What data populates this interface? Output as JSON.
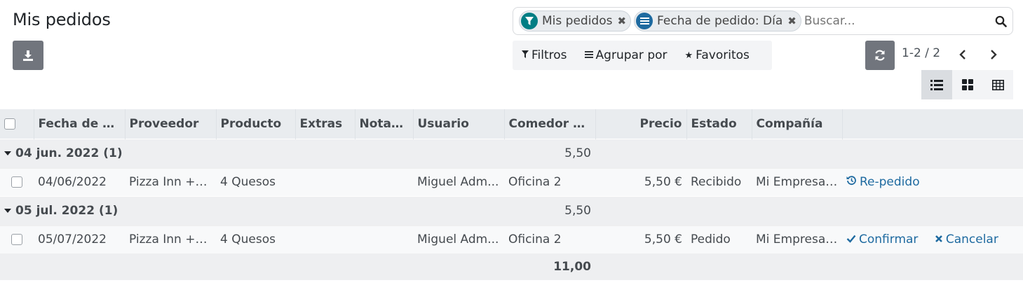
{
  "page": {
    "title": "Mis pedidos"
  },
  "search": {
    "facets": [
      {
        "icon": "filter-icon",
        "label": "Mis pedidos"
      },
      {
        "icon": "group-by-icon",
        "label": "Fecha de pedido: Día"
      }
    ],
    "placeholder": "Buscar..."
  },
  "filterbar": {
    "filters": "Filtros",
    "group_by": "Agrupar por",
    "favorites": "Favoritos"
  },
  "pager": {
    "value": "1-2 / 2"
  },
  "views": [
    "list-view-icon",
    "kanban-view-icon",
    "pivot-view-icon"
  ],
  "table": {
    "headers": [
      "Fecha de p...",
      "Proveedor",
      "Producto",
      "Extras",
      "Notas...",
      "Usuario",
      "Comedor d...",
      "Precio",
      "Estado",
      "Compañía"
    ],
    "groups": [
      {
        "label": "04 jun. 2022 (1)",
        "total": "5,50",
        "rows": [
          {
            "date": "04/06/2022",
            "vendor": "Pizza Inn +3...",
            "product": "4 Quesos",
            "extras": "",
            "notes": "",
            "user": "Miguel Adm...",
            "location": "Oficina 2",
            "price": "5,50 €",
            "state": "Recibido",
            "company": "Mi Empresa ...",
            "actions": [
              {
                "icon": "history-icon",
                "label": "Re-pedido"
              }
            ]
          }
        ]
      },
      {
        "label": "05 jul. 2022 (1)",
        "total": "5,50",
        "rows": [
          {
            "date": "05/07/2022",
            "vendor": "Pizza Inn +3...",
            "product": "4 Quesos",
            "extras": "",
            "notes": "",
            "user": "Miguel Adm...",
            "location": "Oficina 2",
            "price": "5,50 €",
            "state": "Pedido",
            "company": "Mi Empresa ...",
            "actions": [
              {
                "icon": "check-icon",
                "label": "Confirmar"
              },
              {
                "icon": "times-icon",
                "label": "Cancelar"
              }
            ]
          }
        ]
      }
    ],
    "grand_total": "11,00"
  },
  "colors": {
    "accent": "#1e6aa0",
    "facet_filter": "#017e84",
    "button": "#71757d"
  }
}
